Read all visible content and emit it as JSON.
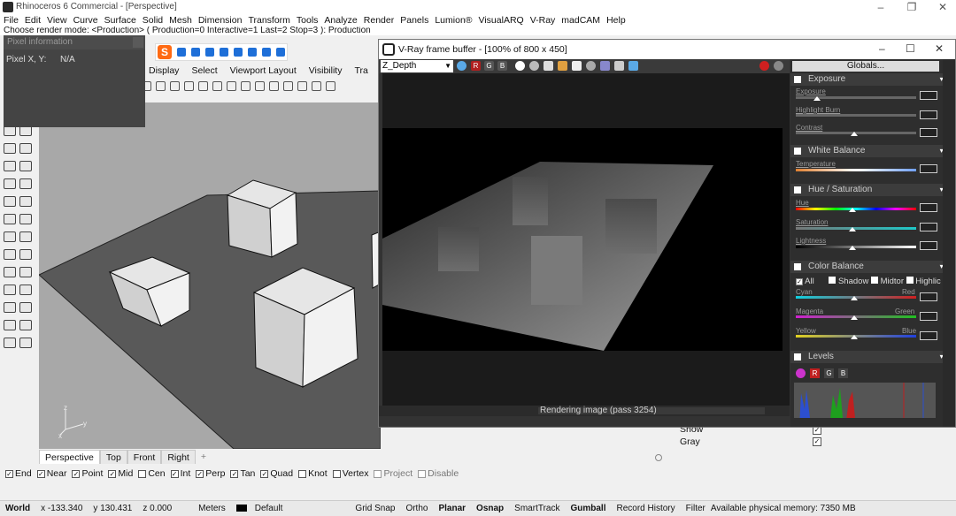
{
  "window": {
    "title": "Rhinoceros 6 Commercial - [Perspective]",
    "controls": [
      "–",
      "❐",
      "✕"
    ]
  },
  "menu": [
    "File",
    "Edit",
    "View",
    "Curve",
    "Surface",
    "Solid",
    "Mesh",
    "Dimension",
    "Transform",
    "Tools",
    "Analyze",
    "Render",
    "Panels",
    "Lumion®",
    "VisualARQ",
    "V-Ray",
    "madCAM",
    "Help"
  ],
  "command_prompt": "Choose render mode: <Production> ( Production=0  Interactive=1  Last=2  Stop=3 ): Production",
  "toolbar_tabs": [
    "Display",
    "Select",
    "Viewport Layout",
    "Visibility",
    "Tra"
  ],
  "pixel_info": {
    "title": "Pixel information",
    "label": "Pixel X, Y:",
    "value": "N/A"
  },
  "vfb": {
    "title": "V-Ray frame buffer - [100% of 800 x 450]",
    "channel": "Z_Depth",
    "status": "Rendering image (pass 3254)",
    "globals_label": "Globals...",
    "sections": {
      "exposure": {
        "title": "Exposure",
        "sliders": [
          "Exposure",
          "Highlight Burn",
          "Contrast"
        ]
      },
      "white_balance": {
        "title": "White Balance",
        "sliders": [
          "Temperature"
        ]
      },
      "hue_saturation": {
        "title": "Hue / Saturation",
        "sliders": [
          "Hue",
          "Saturation",
          "Lightness"
        ]
      },
      "color_balance": {
        "title": "Color Balance",
        "ranges": [
          "All",
          "Shadow",
          "Midtor",
          "Highlic"
        ],
        "sliders": [
          {
            "left": "Cyan",
            "right": "Red"
          },
          {
            "left": "Magenta",
            "right": "Green"
          },
          {
            "left": "Yellow",
            "right": "Blue"
          }
        ]
      },
      "levels": {
        "title": "Levels",
        "channels": [
          "R",
          "G",
          "B"
        ]
      }
    },
    "channel_buttons": [
      "R",
      "G",
      "B"
    ]
  },
  "viewport_tabs": [
    "Perspective",
    "Top",
    "Front",
    "Right",
    "+"
  ],
  "viewport_axes": {
    "x": "x",
    "y": "y",
    "z": "z"
  },
  "properties": {
    "rows": [
      {
        "label": "Show",
        "checked": true
      },
      {
        "label": "Gray",
        "checked": true
      }
    ]
  },
  "osnaps": [
    {
      "label": "End",
      "checked": true
    },
    {
      "label": "Near",
      "checked": true
    },
    {
      "label": "Point",
      "checked": true
    },
    {
      "label": "Mid",
      "checked": true
    },
    {
      "label": "Cen",
      "checked": false
    },
    {
      "label": "Int",
      "checked": true
    },
    {
      "label": "Perp",
      "checked": true
    },
    {
      "label": "Tan",
      "checked": true
    },
    {
      "label": "Quad",
      "checked": true
    },
    {
      "label": "Knot",
      "checked": false
    },
    {
      "label": "Vertex",
      "checked": false
    },
    {
      "label": "Project",
      "checked": false
    },
    {
      "label": "Disable",
      "checked": false
    }
  ],
  "status": {
    "cplane": "World",
    "x": "x -133.340",
    "y": "y 130.431",
    "z": "z 0.000",
    "units": "Meters",
    "layer": "Default",
    "grid_snap": "Grid Snap",
    "ortho": "Ortho",
    "planar": "Planar",
    "osnap": "Osnap",
    "smarttrack": "SmartTrack",
    "gumball": "Gumball",
    "record_history": "Record History",
    "filter": "Filter",
    "memory": "Available physical memory: 7350 MB"
  }
}
